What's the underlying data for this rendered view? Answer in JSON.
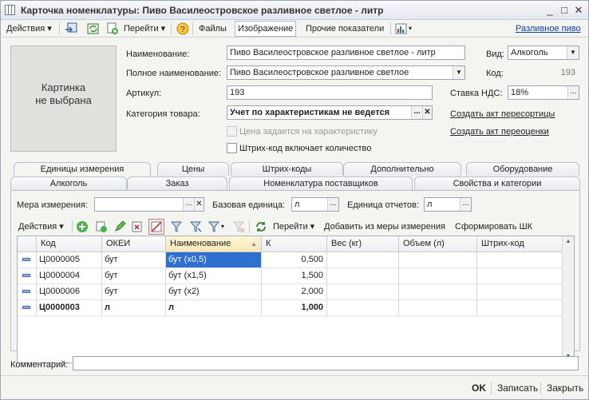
{
  "window": {
    "title": "Карточка номенклатуры: Пиво Василеостровское разливное светлое - литр",
    "minimize": "_",
    "maximize": "□",
    "close": "✕"
  },
  "toolbar": {
    "actions": "Действия",
    "go": "Перейти",
    "files": "Файлы",
    "image": "Изображение",
    "other": "Прочие показатели",
    "right_link": "Разливное пиво"
  },
  "picture": {
    "line1": "Картинка",
    "line2": "не выбрана"
  },
  "form": {
    "name_label": "Наименование:",
    "name_value": "Пиво Василеостровское разливное светлое - литр",
    "full_name_label": "Полное наименование:",
    "full_name_value": "Пиво Василеостровское разливное светлое",
    "article_label": "Артикул:",
    "article_value": "193",
    "category_label": "Категория товара:",
    "category_value": "Учет по характеристикам не ведется",
    "price_by_char_label": "Цена задается на характеристику",
    "barcode_qty_label": "Штрих-код включает количество",
    "kind_label": "Вид:",
    "kind_value": "Алкоголь",
    "code_label": "Код:",
    "code_value": "193",
    "vat_label": "Ставка НДС:",
    "vat_value": "18%",
    "link_resort": "Создать акт пересортицы",
    "link_reval": "Создать акт переоценки"
  },
  "tabs": {
    "row1": [
      "Единицы измерения",
      "Цены",
      "Штрих-коды",
      "Дополнительно",
      "Оборудование"
    ],
    "row2": [
      "Алкоголь",
      "Заказ",
      "Номенклатура поставщиков",
      "Свойства и категории"
    ]
  },
  "units": {
    "measure_label": "Мера измерения:",
    "measure_value": "",
    "base_label": "Базовая единица:",
    "base_value": "л",
    "report_label": "Единица отчетов:",
    "report_value": "л",
    "actions": "Действия",
    "go": "Перейти",
    "add_from_measure": "Добавить из меры измерения",
    "make_barcode": "Сформировать ШК"
  },
  "grid": {
    "columns": [
      "Код",
      "ОКЕИ",
      "Наименование",
      "К",
      "Вес (кг)",
      "Объем (л)",
      "Штрих-код"
    ],
    "rows": [
      {
        "code": "Ц0000005",
        "okei": "бут",
        "name": "бут (x0,5)",
        "k": "0,500",
        "bold": false,
        "selected": true
      },
      {
        "code": "Ц0000004",
        "okei": "бут",
        "name": "бут (x1,5)",
        "k": "1,500",
        "bold": false,
        "selected": false
      },
      {
        "code": "Ц0000006",
        "okei": "бут",
        "name": "бут (x2)",
        "k": "2,000",
        "bold": false,
        "selected": false
      },
      {
        "code": "Ц0000003",
        "okei": "л",
        "name": "л",
        "k": "1,000",
        "bold": true,
        "selected": false
      }
    ]
  },
  "comment": {
    "label": "Комментарий:",
    "value": ""
  },
  "footer": {
    "ok": "OK",
    "save": "Записать",
    "close": "Закрыть"
  },
  "colors": {
    "accent": "#2f6fd0",
    "link": "#0b3fa3",
    "window_bg": "#f4f4f0"
  }
}
